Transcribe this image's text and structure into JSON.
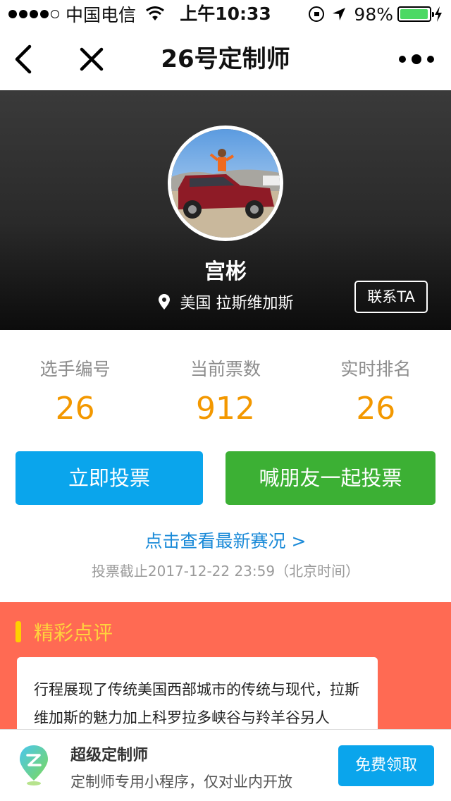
{
  "status_bar": {
    "carrier": "中国电信",
    "time": "上午10:33",
    "battery": "98%",
    "battery_level": 0.98,
    "signal_bars": 4
  },
  "nav": {
    "title": "26号定制师"
  },
  "profile": {
    "name": "宫彬",
    "location": "美国 拉斯维加斯",
    "contact_label": "联系TA"
  },
  "stats": [
    {
      "label": "选手编号",
      "value": "26"
    },
    {
      "label": "当前票数",
      "value": "912"
    },
    {
      "label": "实时排名",
      "value": "26"
    }
  ],
  "actions": {
    "vote_label": "立即投票",
    "share_label": "喊朋友一起投票"
  },
  "latest_link": "点击查看最新赛况 >",
  "deadline": "投票截止2017-12-22 23:59（北京时间）",
  "review": {
    "title": "精彩点评",
    "text": "行程展现了传统美国西部城市的传统与现代，拉斯维加斯的魅力加上科罗拉多峡谷与羚羊谷另人"
  },
  "banner": {
    "title": "超级定制师",
    "subtitle": "定制师专用小程序，仅对业内开放",
    "button_label": "免费领取"
  },
  "colors": {
    "accent_orange": "#f39800",
    "vote_blue": "#0aa5ec",
    "share_green": "#3cb034",
    "review_bg": "#ff6a53",
    "review_title": "#ffd33d",
    "link_blue": "#1a8ad8"
  },
  "icons": [
    "wifi-icon",
    "lock-rotation-icon",
    "location-arrow-icon",
    "battery-icon",
    "charging-icon",
    "back-icon",
    "close-icon",
    "more-icon",
    "location-pin-icon",
    "app-logo-icon"
  ]
}
